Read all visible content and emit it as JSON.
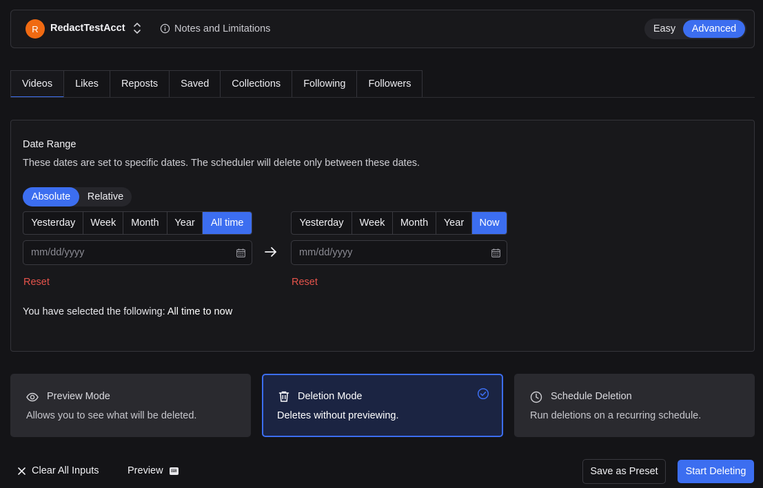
{
  "header": {
    "avatar_letter": "R",
    "account_name": "RedactTestAcct",
    "notes_label": "Notes and Limitations",
    "mode_easy": "Easy",
    "mode_advanced": "Advanced",
    "active_mode": "Advanced"
  },
  "tabs": [
    {
      "label": "Videos",
      "active": true
    },
    {
      "label": "Likes",
      "active": false
    },
    {
      "label": "Reposts",
      "active": false
    },
    {
      "label": "Saved",
      "active": false
    },
    {
      "label": "Collections",
      "active": false
    },
    {
      "label": "Following",
      "active": false
    },
    {
      "label": "Followers",
      "active": false
    }
  ],
  "date_range": {
    "title": "Date Range",
    "description": "These dates are set to specific dates. The scheduler will delete only between these dates.",
    "type_absolute": "Absolute",
    "type_relative": "Relative",
    "start_presets": [
      "Yesterday",
      "Week",
      "Month",
      "Year",
      "All time"
    ],
    "start_active": "All time",
    "end_presets": [
      "Yesterday",
      "Week",
      "Month",
      "Year",
      "Now"
    ],
    "end_active": "Now",
    "start_placeholder": "mm/dd/yyyy",
    "end_placeholder": "mm/dd/yyyy",
    "reset_label": "Reset",
    "selected_prefix": "You have selected the following:",
    "selected_value": "All time to now"
  },
  "modes": {
    "preview": {
      "title": "Preview Mode",
      "desc": "Allows you to see what will be deleted."
    },
    "deletion": {
      "title": "Deletion Mode",
      "desc": "Deletes without previewing.",
      "selected": true
    },
    "schedule": {
      "title": "Schedule Deletion",
      "desc": "Run deletions on a recurring schedule."
    }
  },
  "footer": {
    "clear_label": "Clear All Inputs",
    "preview_label": "Preview",
    "save_preset_label": "Save as Preset",
    "start_label": "Start Deleting"
  },
  "colors": {
    "accent": "#3c6ef0",
    "reset": "#e5534b",
    "avatar": "#f06a12"
  }
}
